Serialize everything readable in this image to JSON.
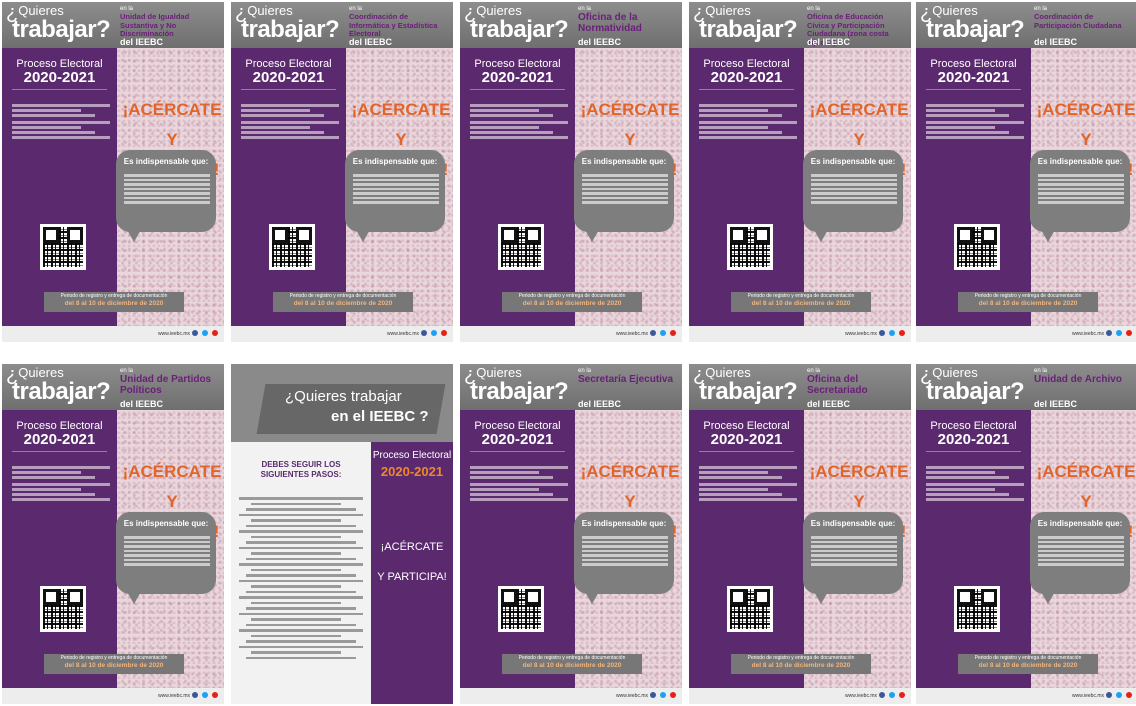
{
  "posters_row1": [
    {
      "quieres": "Quieres",
      "trabajar": "trabajar",
      "en_la": "en la",
      "unit": "Unidad de Igualdad Sustantiva y No Discriminación",
      "del": "del IEEBC",
      "proceso": "Proceso Electoral",
      "year": "2020-2021",
      "acercate": "¡ACÉRCATE",
      "participa": "Y PARTICIPA!",
      "indispensable": "Es indispensable que:",
      "plazo": "Periodo de registro y entrega de documentación",
      "fechas": "del 8 al 10 de diciembre de 2020",
      "footer": "www.ieebc.mx"
    },
    {
      "quieres": "Quieres",
      "trabajar": "trabajar",
      "en_la": "en la",
      "unit": "Coordinación de Informática y Estadística Electoral",
      "del": "del IEEBC",
      "proceso": "Proceso Electoral",
      "year": "2020-2021",
      "acercate": "¡ACÉRCATE",
      "participa": "Y PARTICIPA!",
      "indispensable": "Es indispensable que:",
      "plazo": "Periodo de registro y entrega de documentación",
      "fechas": "del 8 al 10 de diciembre de 2020",
      "footer": "www.ieebc.mx"
    },
    {
      "quieres": "Quieres",
      "trabajar": "trabajar",
      "en_la": "en la",
      "unit": "Oficina de la Normatividad",
      "del": "del IEEBC",
      "proceso": "Proceso Electoral",
      "year": "2020-2021",
      "acercate": "¡ACÉRCATE",
      "participa": "Y PARTICIPA!",
      "indispensable": "Es indispensable que:",
      "plazo": "Periodo de registro y entrega de documentación",
      "fechas": "del 8 al 10 de diciembre de 2020",
      "footer": "www.ieebc.mx"
    },
    {
      "quieres": "Quieres",
      "trabajar": "trabajar",
      "en_la": "en la",
      "unit": "Oficina de Educación Cívica y Participación Ciudadana (zona costa Tijuana)",
      "del": "del IEEBC",
      "proceso": "Proceso Electoral",
      "year": "2020-2021",
      "acercate": "¡ACÉRCATE",
      "participa": "Y PARTICIPA!",
      "indispensable": "Es indispensable que:",
      "plazo": "Periodo de registro y entrega de documentación",
      "fechas": "del 8 al 10 de diciembre de 2020",
      "footer": "www.ieebc.mx"
    },
    {
      "quieres": "Quieres",
      "trabajar": "trabajar",
      "en_la": "en la",
      "unit": "Coordinación de Participación Ciudadana",
      "del": "del IEEBC",
      "proceso": "Proceso Electoral",
      "year": "2020-2021",
      "acercate": "¡ACÉRCATE",
      "participa": "Y PARTICIPA!",
      "indispensable": "Es indispensable que:",
      "plazo": "Periodo de registro y entrega de documentación",
      "fechas": "del 8 al 10 de diciembre de 2020",
      "footer": "www.ieebc.mx"
    }
  ],
  "posters_row2": [
    {
      "quieres": "Quieres",
      "trabajar": "trabajar",
      "en_la": "en la",
      "unit": "Unidad de Partidos Políticos",
      "del": "del IEEBC",
      "proceso": "Proceso Electoral",
      "year": "2020-2021",
      "acercate": "¡ACÉRCATE",
      "participa": "Y PARTICIPA!",
      "indispensable": "Es indispensable que:",
      "plazo": "Periodo de registro y entrega de documentación",
      "fechas": "del 8 al 10 de diciembre de 2020",
      "footer": "www.ieebc.mx"
    },
    {
      "special": true,
      "q1": "¿Quieres trabajar",
      "q2": "en el IEEBC ?",
      "proceso": "Proceso Electoral",
      "year": "2020-2021",
      "debes": "DEBES SEGUIR LOS SIGUIENTES PASOS:",
      "acercate": "¡ACÉRCATE",
      "participa": "Y PARTICIPA!"
    },
    {
      "quieres": "Quieres",
      "trabajar": "trabajar",
      "en_la": "en la",
      "unit": "Secretaría Ejecutiva",
      "del": "del IEEBC",
      "proceso": "Proceso Electoral",
      "year": "2020-2021",
      "acercate": "¡ACÉRCATE",
      "participa": "Y PARTICIPA!",
      "indispensable": "Es indispensable que:",
      "plazo": "Periodo de registro y entrega de documentación",
      "fechas": "del 8 al 10 de diciembre de 2020",
      "footer": "www.ieebc.mx"
    },
    {
      "quieres": "Quieres",
      "trabajar": "trabajar",
      "en_la": "en la",
      "unit": "Oficina del Secretariado",
      "del": "del IEEBC",
      "proceso": "Proceso Electoral",
      "year": "2020-2021",
      "acercate": "¡ACÉRCATE",
      "participa": "Y PARTICIPA!",
      "indispensable": "Es indispensable que:",
      "plazo": "Periodo de registro y entrega de documentación",
      "fechas": "del 8 al 10 de diciembre de 2020",
      "footer": "www.ieebc.mx"
    },
    {
      "quieres": "Quieres",
      "trabajar": "trabajar",
      "en_la": "en la",
      "unit": "Unidad de Archivo",
      "del": "del IEEBC",
      "proceso": "Proceso Electoral",
      "year": "2020-2021",
      "acercate": "¡ACÉRCATE",
      "participa": "Y PARTICIPA!",
      "indispensable": "Es indispensable que:",
      "plazo": "Periodo de registro y entrega de documentación",
      "fechas": "del 8 al 10 de diciembre de 2020",
      "footer": "www.ieebc.mx"
    }
  ],
  "colors": {
    "purple": "#5b2a6e",
    "orange": "#e0652a",
    "gray": "#7e7e7e",
    "unit_text": "#6a1f78"
  }
}
